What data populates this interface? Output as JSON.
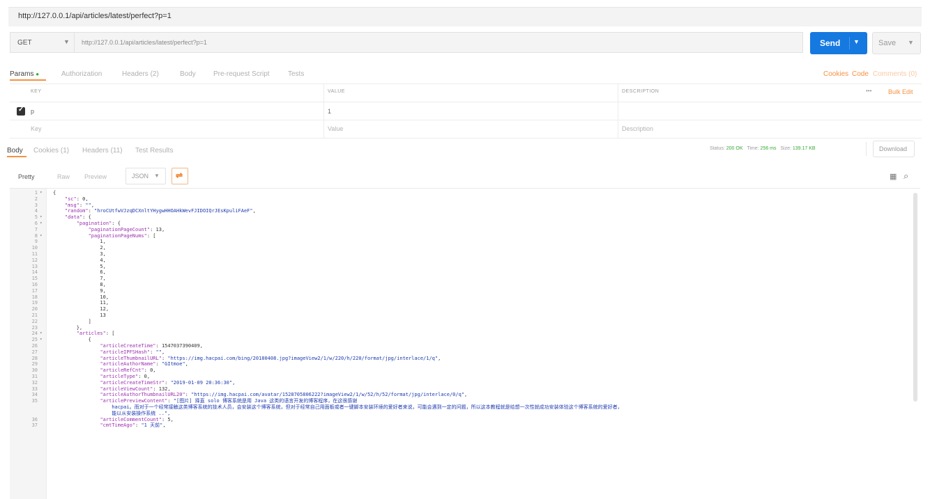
{
  "tab": {
    "title": "http://127.0.0.1/api/articles/latest/perfect?p=1"
  },
  "request": {
    "method": "GET",
    "url": "http://127.0.0.1/api/articles/latest/perfect?p=1",
    "send_label": "Send",
    "save_label": "Save"
  },
  "request_tabs": [
    "Params",
    "Authorization",
    "Headers (2)",
    "Body",
    "Pre-request Script",
    "Tests"
  ],
  "request_links": {
    "cookies": "Cookies",
    "code": "Code",
    "comments": "Comments (0)"
  },
  "params": {
    "headers": {
      "key": "KEY",
      "value": "VALUE",
      "description": "DESCRIPTION"
    },
    "more": "•••",
    "bulk_edit": "Bulk Edit",
    "rows": [
      {
        "key": "p",
        "value": "1",
        "description": "",
        "checked": true
      }
    ],
    "placeholders": {
      "key": "Key",
      "value": "Value",
      "description": "Description"
    }
  },
  "response_tabs": [
    "Body",
    "Cookies (1)",
    "Headers (11)",
    "Test Results"
  ],
  "status": {
    "status_label": "Status:",
    "status_value": "200 OK",
    "time_label": "Time:",
    "time_value": "256 ms",
    "size_label": "Size:",
    "size_value": "139.17 KB",
    "download": "Download"
  },
  "format": {
    "pretty": "Pretty",
    "raw": "Raw",
    "preview": "Preview",
    "lang": "JSON"
  },
  "icons": {
    "copy": "copy-icon",
    "search": "search-icon",
    "wrap": "wrap-lines-icon"
  },
  "colors": {
    "accent": "#1579e0",
    "orange": "#f6913f",
    "status": "#38a837"
  },
  "code_lines": [
    {
      "n": "1",
      "fold": true,
      "text": "{"
    },
    {
      "n": "2",
      "text": "    \"sc\": 0,"
    },
    {
      "n": "3",
      "text": "    \"msg\": \"\","
    },
    {
      "n": "4",
      "text": "    \"random\": \"hroCUtfwVJzqDCXnltYHygwHHOAHkWevFJIDOIQrJEsKpuliFAeF\","
    },
    {
      "n": "5",
      "fold": true,
      "text": "    \"data\": {"
    },
    {
      "n": "6",
      "fold": true,
      "text": "        \"pagination\": {"
    },
    {
      "n": "7",
      "text": "            \"paginationPageCount\": 13,"
    },
    {
      "n": "8",
      "fold": true,
      "text": "            \"paginationPageNums\": ["
    },
    {
      "n": "9",
      "text": "                1,"
    },
    {
      "n": "10",
      "text": "                2,"
    },
    {
      "n": "11",
      "text": "                3,"
    },
    {
      "n": "12",
      "text": "                4,"
    },
    {
      "n": "13",
      "text": "                5,"
    },
    {
      "n": "14",
      "text": "                6,"
    },
    {
      "n": "15",
      "text": "                7,"
    },
    {
      "n": "16",
      "text": "                8,"
    },
    {
      "n": "17",
      "text": "                9,"
    },
    {
      "n": "18",
      "text": "                10,"
    },
    {
      "n": "19",
      "text": "                11,"
    },
    {
      "n": "20",
      "text": "                12,"
    },
    {
      "n": "21",
      "text": "                13"
    },
    {
      "n": "22",
      "text": "            ]"
    },
    {
      "n": "23",
      "text": "        },"
    },
    {
      "n": "24",
      "fold": true,
      "text": "        \"articles\": ["
    },
    {
      "n": "25",
      "fold": true,
      "text": "            {"
    },
    {
      "n": "26",
      "text": "                \"articleCreateTime\": 1547037390409,"
    },
    {
      "n": "27",
      "text": "                \"articleIPFSHash\": \"\","
    },
    {
      "n": "28",
      "text": "                \"articleThumbnailURL\": \"https://img.hacpai.com/bing/20180408.jpg?imageView2/1/w/220/h/220/format/jpg/interlace/1/q\","
    },
    {
      "n": "29",
      "text": "                \"articleAuthorName\": \"GItmoe\","
    },
    {
      "n": "30",
      "text": "                \"articleRefCnt\": 0,"
    },
    {
      "n": "31",
      "text": "                \"articleType\": 0,"
    },
    {
      "n": "32",
      "text": "                \"articleCreateTimeStr\": \"2019-01-09 20:36:30\","
    },
    {
      "n": "33",
      "text": "                \"articleViewCount\": 132,"
    },
    {
      "n": "34",
      "text": "                \"articleAuthorThumbnailURL20\": \"https://img.hacpai.com/avatar/1528705806222?imageView2/1/w/52/h/52/format/jpg/interlace/0/q\","
    },
    {
      "n": "35",
      "text": "                \"articlePreviewContent\": \"[图片] 择直 solo 博客系统是用 Java 这类的语言开发的博客程序，在这很感谢"
    },
    {
      "n": "",
      "text": "                    hacpai。而对于一个经常接触这类博客系统的技术人员，会安装这个博客系统，但对于经常自己用面板或者一键脚本安装环境的爱好者来说，可能会遇到一定的问题，所以这本教程就是给想一次性就成功安装体验这个博客系统的爱好者，"
    },
    {
      "n": "",
      "text": "                    能以从安装操作系统 ..\","
    },
    {
      "n": "36",
      "text": "                \"articleCommentCount\": 5,"
    },
    {
      "n": "37",
      "text": "                \"cmtTimeAgo\": \"1 天前\","
    }
  ]
}
